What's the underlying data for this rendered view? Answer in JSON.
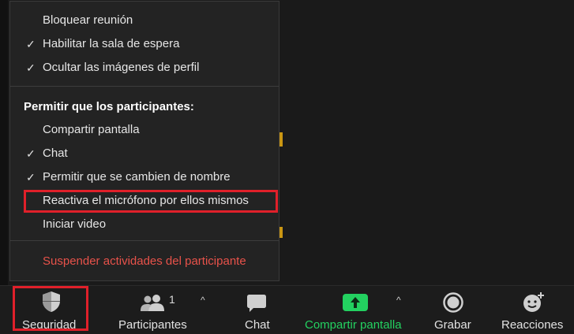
{
  "security_menu": {
    "items": [
      {
        "label": "Bloquear reunión",
        "checked": false
      },
      {
        "label": "Habilitar la sala de espera",
        "checked": true
      },
      {
        "label": "Ocultar las imágenes de perfil",
        "checked": true
      }
    ],
    "section_header": "Permitir que los participantes:",
    "participant_items": [
      {
        "label": "Compartir pantalla",
        "checked": false
      },
      {
        "label": "Chat",
        "checked": true
      },
      {
        "label": "Permitir que se cambien de nombre",
        "checked": true
      },
      {
        "label": "Reactiva el micrófono por ellos mismos",
        "checked": false
      },
      {
        "label": "Iniciar video",
        "checked": false
      }
    ],
    "danger_action": "Suspender actividades del participante",
    "check_glyph": "✓"
  },
  "toolbar": {
    "security_label": "Seguridad",
    "participants_label": "Participantes",
    "participants_count": "1",
    "chat_label": "Chat",
    "share_label": "Compartir pantalla",
    "record_label": "Grabar",
    "reactions_label": "Reacciones",
    "caret_glyph": "^"
  },
  "colors": {
    "menu_background": "#232323",
    "danger": "#e8524a",
    "highlight": "#e0202a",
    "share_green": "#23d160"
  },
  "icons": [
    "check-icon",
    "shield-icon",
    "participants-icon",
    "chat-icon",
    "share-screen-icon",
    "record-icon",
    "reactions-icon",
    "caret-up-icon"
  ]
}
